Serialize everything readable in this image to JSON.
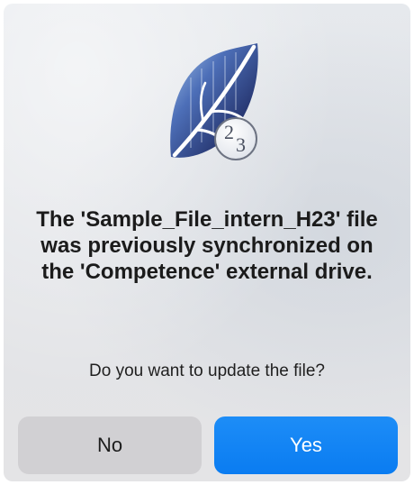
{
  "dialog": {
    "icon": "app-leaf-23-icon",
    "icon_badge_text": "23",
    "title": "The 'Sample_File_intern_H23' file was previously synchronized on the 'Competence' external drive.",
    "message": "Do you want to update the file?",
    "buttons": {
      "no_label": "No",
      "yes_label": "Yes"
    },
    "colors": {
      "primary_button": "#0a7cf1",
      "secondary_button": "#d1d0d3",
      "background": "#e4e6ea"
    }
  }
}
